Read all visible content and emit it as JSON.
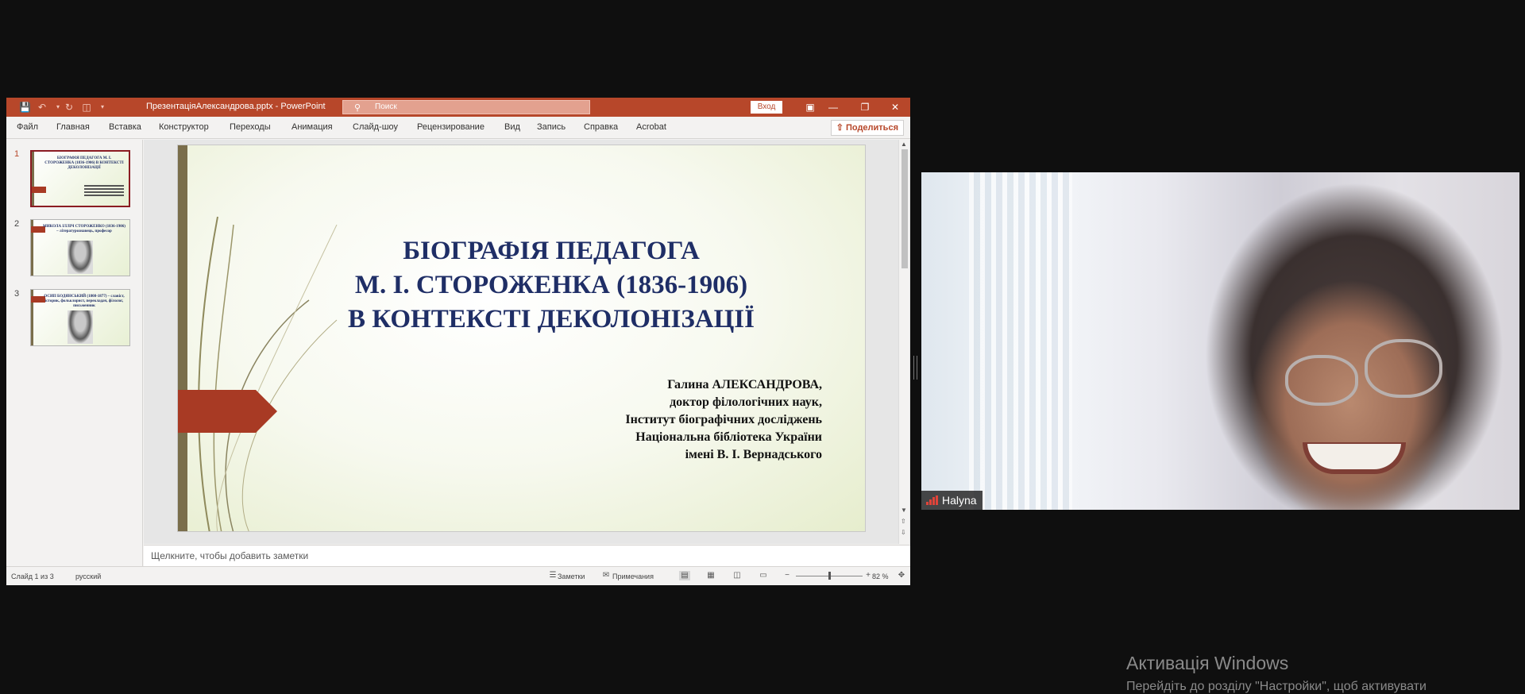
{
  "ppt": {
    "title": "ПрезентаціяАлександрова.pptx  -  PowerPoint",
    "search_placeholder": "Поиск",
    "signin_label": "Вход",
    "menu": [
      "Файл",
      "Главная",
      "Вставка",
      "Конструктор",
      "Переходы",
      "Анимация",
      "Слайд-шоу",
      "Рецензирование",
      "Вид",
      "Запись",
      "Справка",
      "Acrobat"
    ],
    "share_label": "Поделиться",
    "thumbnails": [
      {
        "num": "1",
        "text": "БІОГРАФІЯ ПЕДАГОГА М. І. СТОРОЖЕНКА (1836-1906) В КОНТЕКСТІ ДЕКОЛОНІЗАЦІЇ"
      },
      {
        "num": "2",
        "text": "МИКОЛА ІЛЛІЧ СТОРОЖЕНКО (1836-1906) – літературознавець, професор"
      },
      {
        "num": "3",
        "text": "ОСИП БОДЯНСЬКИЙ (1808-1877) – славіст, історик, фольклорист, перекладач, філолог, письменник"
      }
    ],
    "slide": {
      "title_lines": [
        "БІОГРАФІЯ ПЕДАГОГА",
        "М. І. СТОРОЖЕНКА (1836-1906)",
        "В КОНТЕКСТІ ДЕКОЛОНІЗАЦІЇ"
      ],
      "author_lines": [
        "Галина АЛЕКСАНДРОВА,",
        "доктор філологічних наук,",
        "Інститут біографічних досліджень",
        "Національна бібліотека України",
        "імені В. І. Вернадського"
      ]
    },
    "notes_placeholder": "Щелкните, чтобы добавить заметки",
    "status": {
      "slide_of": "Слайд 1 из 3",
      "language": "русский",
      "notes_label": "Заметки",
      "comments_label": "Примечания",
      "zoom": "82 %"
    },
    "colors": {
      "accent": "#b7472a",
      "slide_title": "#1f2e66",
      "arrow": "#a83a24"
    }
  },
  "video": {
    "participant_name": "Halyna"
  },
  "watermark": {
    "title": "Активація Windows",
    "subtitle": "Перейдіть до розділу \"Настройки\", щоб активувати"
  }
}
